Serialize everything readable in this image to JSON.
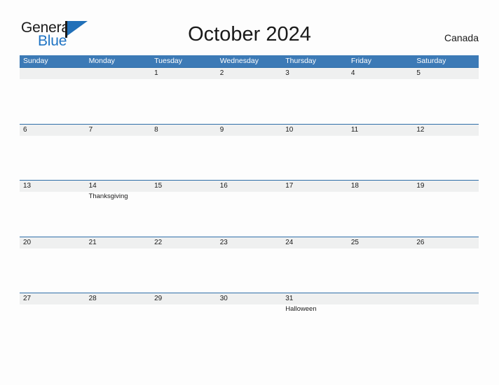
{
  "brand": {
    "word_one": "General",
    "word_two": "Blue",
    "flag_color": "#2170b8",
    "text_color": "#1a1a1a"
  },
  "header": {
    "title": "October 2024",
    "country": "Canada"
  },
  "theme": {
    "header_blue": "#3c7ab6",
    "band_gray": "#eff0f0",
    "band_border": "#2f6ea8",
    "page_background": "#fdfdfd"
  },
  "calendar": {
    "weekdays": [
      "Sunday",
      "Monday",
      "Tuesday",
      "Wednesday",
      "Thursday",
      "Friday",
      "Saturday"
    ],
    "weeks": [
      [
        {
          "day": "",
          "event": ""
        },
        {
          "day": "",
          "event": ""
        },
        {
          "day": "1",
          "event": ""
        },
        {
          "day": "2",
          "event": ""
        },
        {
          "day": "3",
          "event": ""
        },
        {
          "day": "4",
          "event": ""
        },
        {
          "day": "5",
          "event": ""
        }
      ],
      [
        {
          "day": "6",
          "event": ""
        },
        {
          "day": "7",
          "event": ""
        },
        {
          "day": "8",
          "event": ""
        },
        {
          "day": "9",
          "event": ""
        },
        {
          "day": "10",
          "event": ""
        },
        {
          "day": "11",
          "event": ""
        },
        {
          "day": "12",
          "event": ""
        }
      ],
      [
        {
          "day": "13",
          "event": ""
        },
        {
          "day": "14",
          "event": "Thanksgiving"
        },
        {
          "day": "15",
          "event": ""
        },
        {
          "day": "16",
          "event": ""
        },
        {
          "day": "17",
          "event": ""
        },
        {
          "day": "18",
          "event": ""
        },
        {
          "day": "19",
          "event": ""
        }
      ],
      [
        {
          "day": "20",
          "event": ""
        },
        {
          "day": "21",
          "event": ""
        },
        {
          "day": "22",
          "event": ""
        },
        {
          "day": "23",
          "event": ""
        },
        {
          "day": "24",
          "event": ""
        },
        {
          "day": "25",
          "event": ""
        },
        {
          "day": "26",
          "event": ""
        }
      ],
      [
        {
          "day": "27",
          "event": ""
        },
        {
          "day": "28",
          "event": ""
        },
        {
          "day": "29",
          "event": ""
        },
        {
          "day": "30",
          "event": ""
        },
        {
          "day": "31",
          "event": "Halloween"
        },
        {
          "day": "",
          "event": ""
        },
        {
          "day": "",
          "event": ""
        }
      ]
    ]
  }
}
